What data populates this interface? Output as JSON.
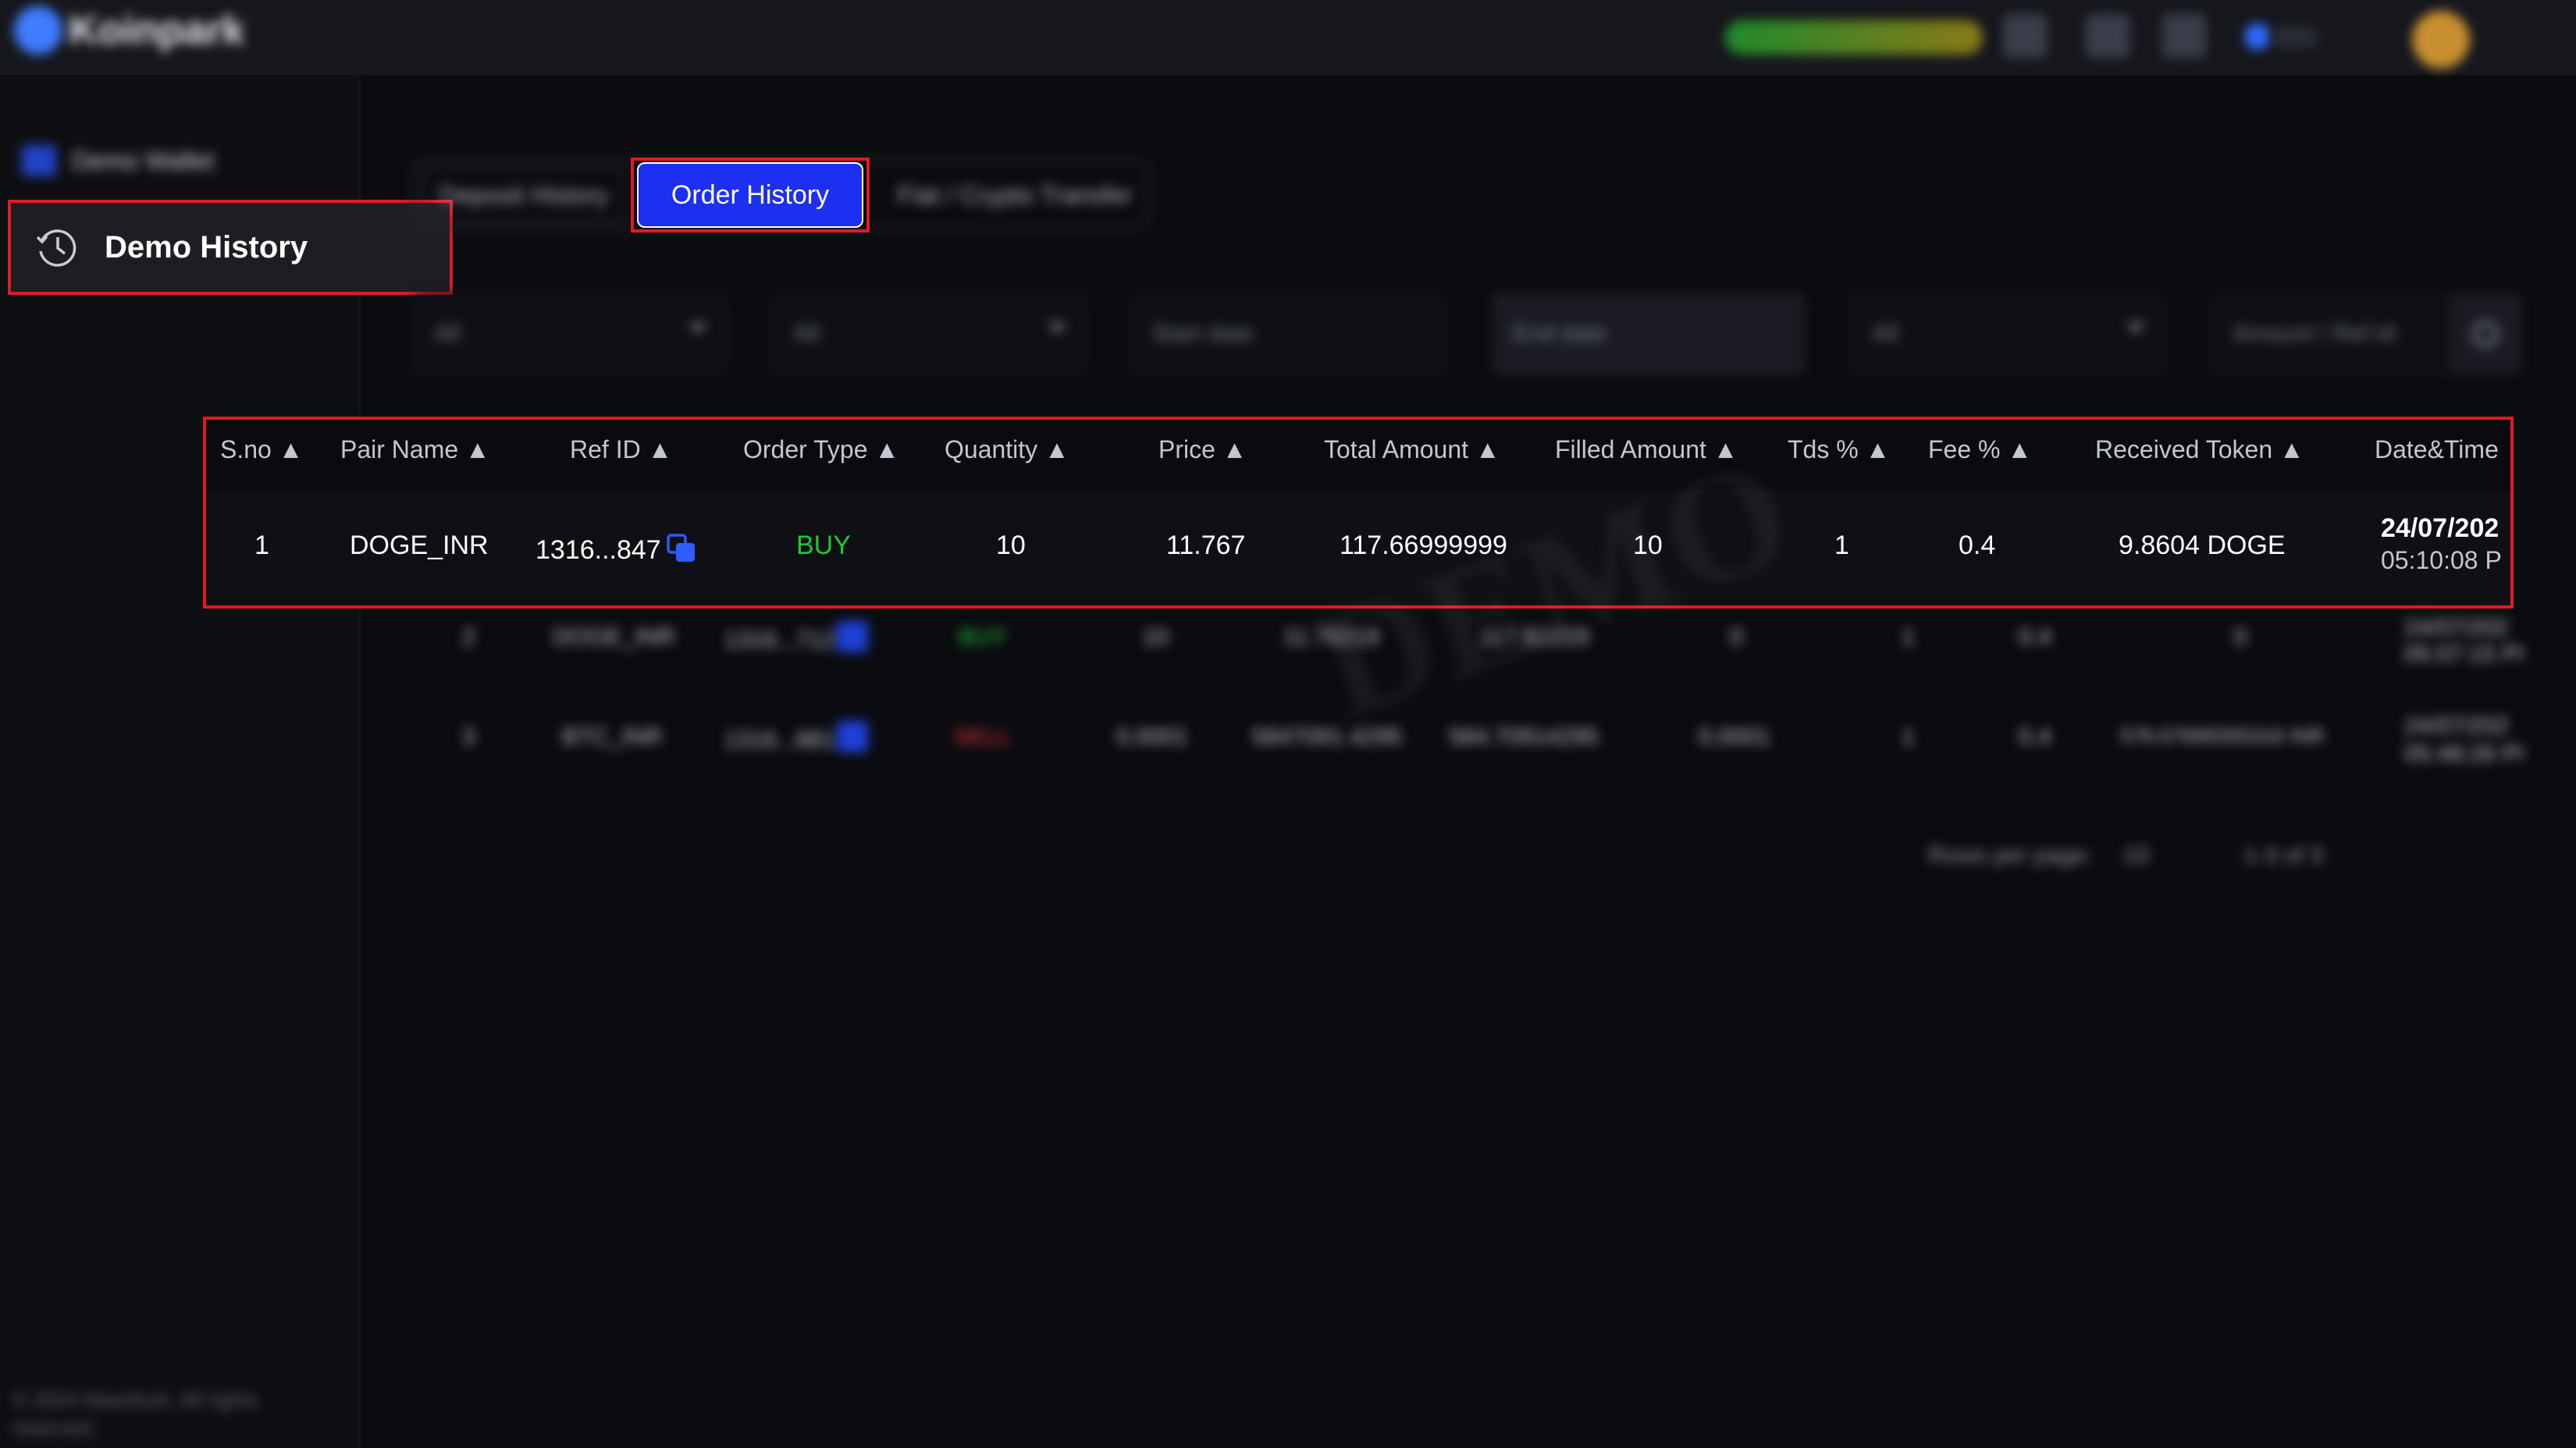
{
  "header": {
    "logo_text": "Koinpark",
    "live_button_label": "Start Live Trading",
    "icons": [
      "rank-icon",
      "chart-icon",
      "box-icon",
      "theme-toggle-icon",
      "avatar"
    ]
  },
  "sidebar": {
    "wallet_label": "Demo Wallet",
    "history_label": "Demo History",
    "footer": "© 2024 Massfuck. All rights reserved."
  },
  "tabs": {
    "deposit": "Deposit History",
    "order": "Order History",
    "fiat": "Fiat / Crypto Transfer"
  },
  "filters": {
    "pair": "All",
    "type": "All",
    "start": "Start date",
    "end": "End date",
    "status": "All",
    "search": "Amount / Ref.Id"
  },
  "table": {
    "headers": [
      "S.no ▲",
      "Pair Name ▲",
      "Ref ID ▲",
      "Order Type ▲",
      "Quantity ▲",
      "Price ▲",
      "Total Amount ▲",
      "Filled Amount ▲",
      "Tds % ▲",
      "Fee % ▲",
      "Received Token ▲",
      "Date&Time"
    ],
    "row1": {
      "sno": "1",
      "pair": "DOGE_INR",
      "ref": "1316...847",
      "type": "BUY",
      "qty": "10",
      "price": "11.767",
      "total": "117.66999999",
      "filled": "10",
      "tds": "1",
      "fee": "0.4",
      "received": "9.8604 DOGE",
      "date": "24/07/202",
      "time": "05:10:08 P"
    },
    "row2": {
      "sno": "2",
      "pair": "DOGE_INR",
      "ref": "1316...712",
      "type": "BUY",
      "qty": "10",
      "price": "11.76219",
      "total": "117.62219",
      "filled": "0",
      "tds": "1",
      "fee": "0.4",
      "received": "0",
      "date": "24/07/202",
      "time": "05:07:15 PI"
    },
    "row3": {
      "sno": "3",
      "pair": "BTC_INR",
      "ref": "1316...881",
      "type": "SELL",
      "qty": "0.0001",
      "price": "5847091.4295",
      "total": "584.70914295",
      "filled": "0.0001",
      "tds": "1",
      "fee": "0.4",
      "received": "576.67699355316 INR",
      "date": "24/07/202",
      "time": "05:48:26 PI"
    }
  },
  "pagination": {
    "rows_label": "Rows per page:",
    "rows_value": "10",
    "range": "1-3 of 3"
  },
  "watermark": "DEMO"
}
